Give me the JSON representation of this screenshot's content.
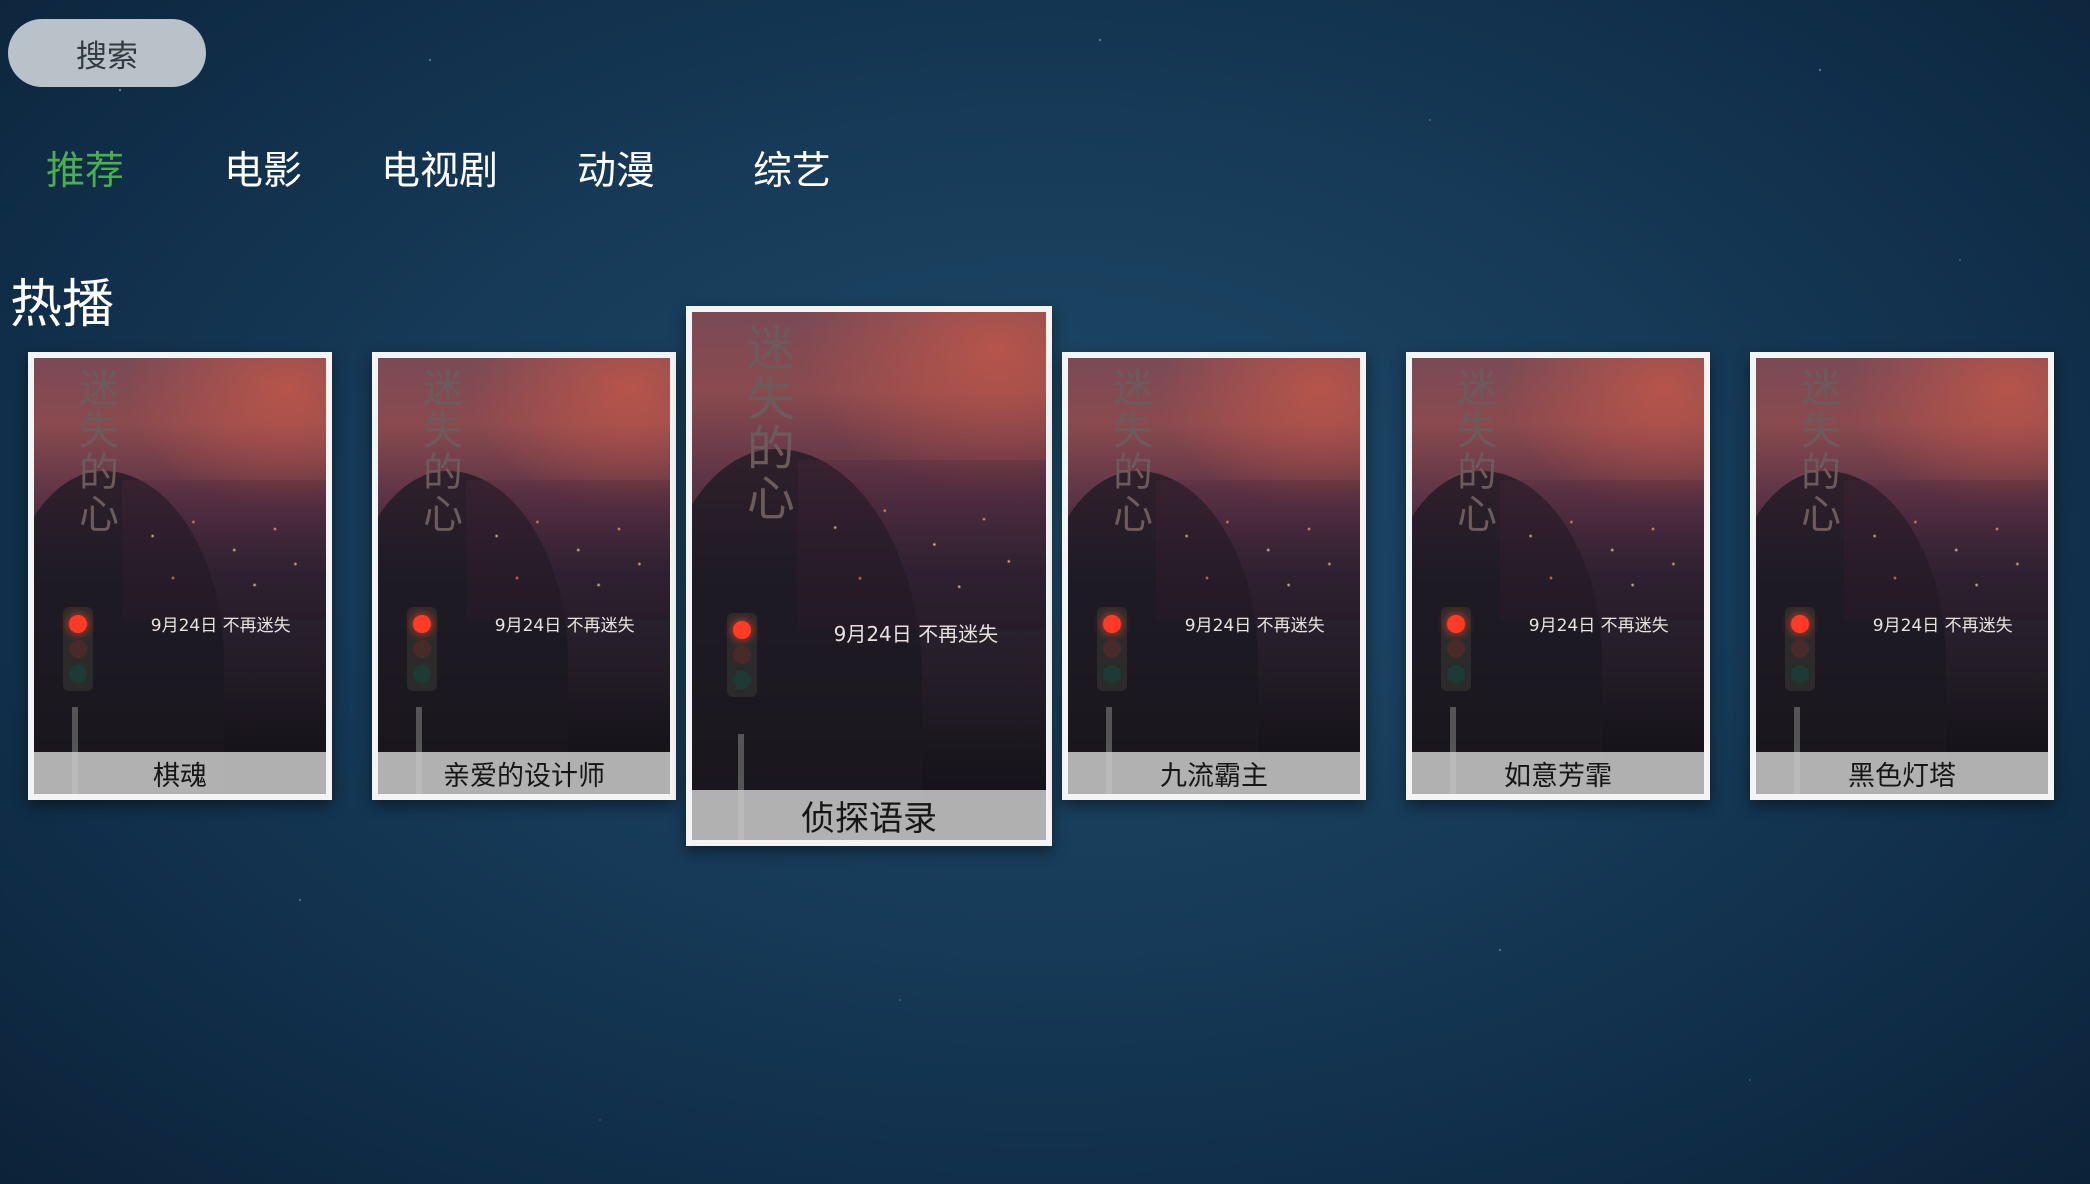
{
  "search": {
    "label": "搜索"
  },
  "tabs": [
    {
      "label": "推荐",
      "active": true
    },
    {
      "label": "电影",
      "active": false
    },
    {
      "label": "电视剧",
      "active": false
    },
    {
      "label": "动漫",
      "active": false
    },
    {
      "label": "综艺",
      "active": false
    }
  ],
  "section": {
    "title": "热播"
  },
  "poster": {
    "title_art": "迷失的心",
    "release_text": "9月24日 不再迷失"
  },
  "cards": [
    {
      "title": "棋魂"
    },
    {
      "title": "亲爱的设计师"
    },
    {
      "title": "侦探语录",
      "focused": true
    },
    {
      "title": "九流霸主"
    },
    {
      "title": "如意芳霏"
    },
    {
      "title": "黑色灯塔"
    }
  ],
  "colors": {
    "active_tab": "#4cae50",
    "search_bg": "#b9c1c9",
    "card_border": "#f4f4f4"
  }
}
